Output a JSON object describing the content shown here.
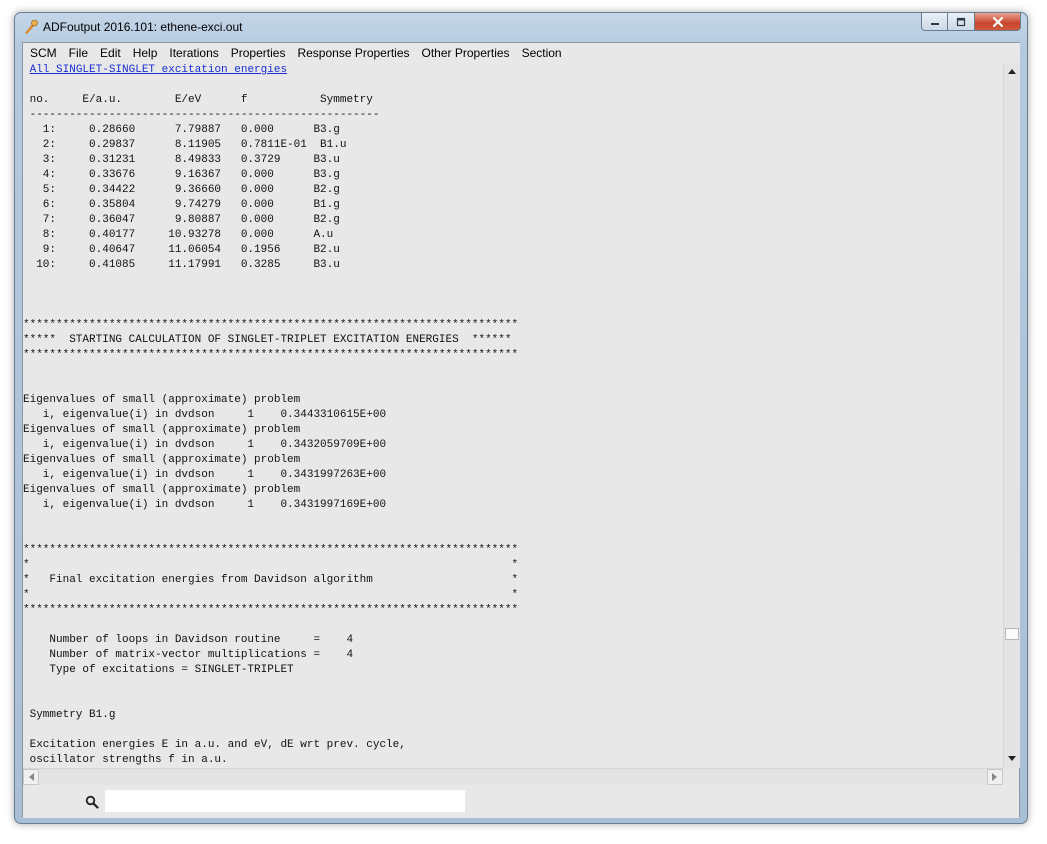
{
  "window": {
    "title": "ADFoutput 2016.101: ethene-exci.out",
    "icon": "adf-app-icon",
    "buttons": {
      "minimize": "minimize-icon",
      "maximize": "maximize-icon",
      "close": "close-icon"
    }
  },
  "menu": {
    "items": [
      "SCM",
      "File",
      "Edit",
      "Help",
      "Iterations",
      "Properties",
      "Response Properties",
      "Other Properties",
      "Section"
    ]
  },
  "content": {
    "link_text": "All SINGLET-SINGLET excitation energies",
    "lines_before": [
      "",
      " no.     E/a.u.        E/eV      f           Symmetry",
      " -----------------------------------------------------",
      "   1:     0.28660      7.79887   0.000      B3.g",
      "   2:     0.29837      8.11905   0.7811E-01  B1.u",
      "   3:     0.31231      8.49833   0.3729     B3.u",
      "   4:     0.33676      9.16367   0.000      B3.g",
      "   5:     0.34422      9.36660   0.000      B2.g",
      "   6:     0.35804      9.74279   0.000      B1.g",
      "   7:     0.36047      9.80887   0.000      B2.g",
      "   8:     0.40177     10.93278   0.000      A.u",
      "   9:     0.40647     11.06054   0.1956     B2.u",
      "  10:     0.41085     11.17991   0.3285     B3.u",
      "",
      "",
      "",
      "***************************************************************************",
      "*****  STARTING CALCULATION OF SINGLET-TRIPLET EXCITATION ENERGIES  ******",
      "***************************************************************************",
      "",
      "",
      "Eigenvalues of small (approximate) problem",
      "   i, eigenvalue(i) in dvdson     1    0.3443310615E+00",
      "Eigenvalues of small (approximate) problem",
      "   i, eigenvalue(i) in dvdson     1    0.3432059709E+00",
      "Eigenvalues of small (approximate) problem",
      "   i, eigenvalue(i) in dvdson     1    0.3431997263E+00",
      "Eigenvalues of small (approximate) problem",
      "   i, eigenvalue(i) in dvdson     1    0.3431997169E+00",
      "",
      "",
      "***************************************************************************",
      "*                                                                         *",
      "*   Final excitation energies from Davidson algorithm                     *",
      "*                                                                         *",
      "***************************************************************************",
      "",
      "    Number of loops in Davidson routine     =    4",
      "    Number of matrix-vector multiplications =    4",
      "    Type of excitations = SINGLET-TRIPLET",
      "",
      "",
      " Symmetry B1.g",
      "",
      " Excitation energies E in a.u. and eV, dE wrt prev. cycle,",
      " oscillator strengths f in a.u."
    ]
  },
  "search": {
    "placeholder": "",
    "value": "",
    "icon": "search-icon"
  }
}
